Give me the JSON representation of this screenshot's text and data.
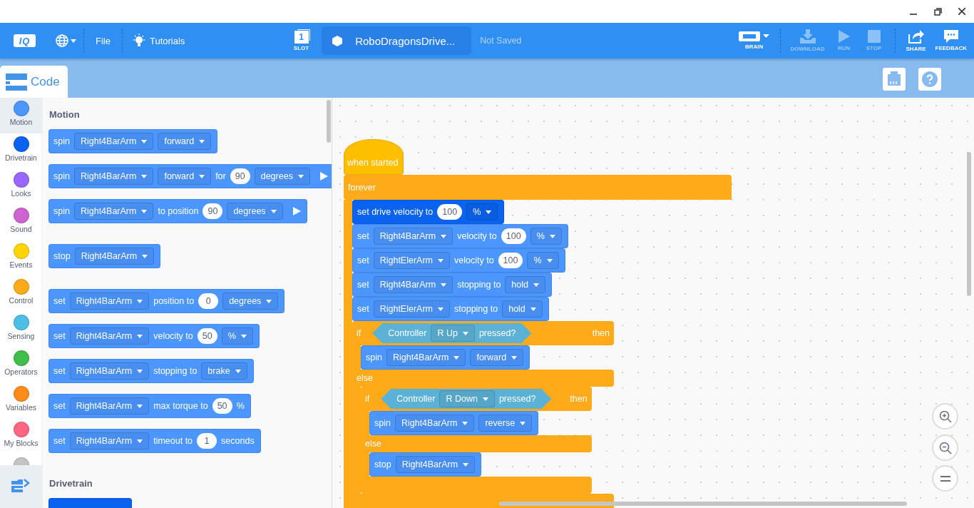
{
  "toolbar": {
    "logo": "IQ",
    "file": "File",
    "tutorials": "Tutorials",
    "slot": {
      "number": "1",
      "label": "SLOT"
    },
    "project_name": "RoboDragonsDrive...",
    "save_status": "Not Saved",
    "actions": [
      {
        "label": "BRAIN",
        "kind": "brain",
        "disabled": false
      },
      {
        "label": "DOWNLOAD",
        "kind": "download",
        "disabled": true
      },
      {
        "label": "RUN",
        "kind": "run",
        "disabled": true
      },
      {
        "label": "STOP",
        "kind": "stop",
        "disabled": true
      },
      {
        "label": "SHARE",
        "kind": "share",
        "disabled": false
      },
      {
        "label": "FEEDBACK",
        "kind": "feedback",
        "disabled": false
      }
    ]
  },
  "tabs": [
    {
      "label": "Code",
      "selected": true
    }
  ],
  "categories": [
    {
      "name": "Motion",
      "color": "#4c97ff",
      "selected": true
    },
    {
      "name": "Drivetrain",
      "color": "#0a63f0",
      "selected": false
    },
    {
      "name": "Looks",
      "color": "#9966ff",
      "selected": false
    },
    {
      "name": "Sound",
      "color": "#cf63cf",
      "selected": false
    },
    {
      "name": "Events",
      "color": "#ffd500",
      "selected": false
    },
    {
      "name": "Control",
      "color": "#ffab19",
      "selected": false
    },
    {
      "name": "Sensing",
      "color": "#4cbfe6",
      "selected": false
    },
    {
      "name": "Operators",
      "color": "#40bf4a",
      "selected": false
    },
    {
      "name": "Variables",
      "color": "#ff8c1a",
      "selected": false
    },
    {
      "name": "My Blocks",
      "color": "#ff6680",
      "selected": false
    },
    {
      "color": "#c4c4c4",
      "selected": false
    }
  ],
  "palette": [
    {
      "title": "Motion",
      "groups": [
        [
          {
            "color": "#4c97ff",
            "parts": [
              {
                "kind": "label",
                "text": "spin"
              },
              {
                "kind": "dropdown",
                "text": "Right4BarArm"
              },
              {
                "kind": "dropdown",
                "text": "forward"
              }
            ]
          },
          {
            "color": "#4c97ff",
            "parts": [
              {
                "kind": "label",
                "text": "spin"
              },
              {
                "kind": "dropdown",
                "text": "Right4BarArm"
              },
              {
                "kind": "dropdown",
                "text": "forward"
              },
              {
                "kind": "label",
                "text": "for"
              },
              {
                "kind": "number",
                "text": "90"
              },
              {
                "kind": "dropdown",
                "text": "degrees"
              },
              {
                "kind": "play"
              }
            ]
          },
          {
            "color": "#4c97ff",
            "parts": [
              {
                "kind": "label",
                "text": "spin"
              },
              {
                "kind": "dropdown",
                "text": "Right4BarArm"
              },
              {
                "kind": "label",
                "text": "to position"
              },
              {
                "kind": "number",
                "text": "90"
              },
              {
                "kind": "dropdown",
                "text": "degrees"
              },
              {
                "kind": "play"
              }
            ]
          }
        ],
        [
          {
            "color": "#4c97ff",
            "parts": [
              {
                "kind": "label",
                "text": "stop"
              },
              {
                "kind": "dropdown",
                "text": "Right4BarArm"
              }
            ]
          }
        ],
        [
          {
            "color": "#4c97ff",
            "parts": [
              {
                "kind": "label",
                "text": "set"
              },
              {
                "kind": "dropdown",
                "text": "Right4BarArm"
              },
              {
                "kind": "label",
                "text": "position to"
              },
              {
                "kind": "number",
                "text": "0"
              },
              {
                "kind": "dropdown",
                "text": "degrees"
              }
            ]
          },
          {
            "color": "#4c97ff",
            "parts": [
              {
                "kind": "label",
                "text": "set"
              },
              {
                "kind": "dropdown",
                "text": "Right4BarArm"
              },
              {
                "kind": "label",
                "text": "velocity to"
              },
              {
                "kind": "number",
                "text": "50"
              },
              {
                "kind": "dropdown",
                "text": "%"
              }
            ]
          },
          {
            "color": "#4c97ff",
            "parts": [
              {
                "kind": "label",
                "text": "set"
              },
              {
                "kind": "dropdown",
                "text": "Right4BarArm"
              },
              {
                "kind": "label",
                "text": "stopping to"
              },
              {
                "kind": "dropdown",
                "text": "brake"
              }
            ]
          },
          {
            "color": "#4c97ff",
            "parts": [
              {
                "kind": "label",
                "text": "set"
              },
              {
                "kind": "dropdown",
                "text": "Right4BarArm"
              },
              {
                "kind": "label",
                "text": "max torque to"
              },
              {
                "kind": "number",
                "text": "50"
              },
              {
                "kind": "label",
                "text": "%"
              }
            ]
          },
          {
            "color": "#4c97ff",
            "parts": [
              {
                "kind": "label",
                "text": "set"
              },
              {
                "kind": "dropdown",
                "text": "Right4BarArm"
              },
              {
                "kind": "label",
                "text": "timeout to"
              },
              {
                "kind": "number",
                "text": "1"
              },
              {
                "kind": "label",
                "text": "seconds"
              }
            ]
          }
        ]
      ]
    },
    {
      "title": "Drivetrain",
      "groups": [
        [
          {
            "color": "#0a63f0"
          }
        ]
      ]
    }
  ],
  "script": [
    {
      "kind": "hat",
      "color": "#ffbf00",
      "parts": [
        {
          "kind": "label",
          "text": "when started"
        }
      ]
    },
    {
      "kind": "forever",
      "color": "#ffab19",
      "label": "forever",
      "body": [
        {
          "kind": "block",
          "color": "#0a63f0",
          "parts": [
            {
              "kind": "label",
              "text": "set drive velocity to"
            },
            {
              "kind": "number",
              "text": "100"
            },
            {
              "kind": "dropdown",
              "text": "%"
            }
          ]
        },
        {
          "kind": "block",
          "color": "#4c97ff",
          "parts": [
            {
              "kind": "label",
              "text": "set"
            },
            {
              "kind": "dropdown",
              "text": "Right4BarArm"
            },
            {
              "kind": "label",
              "text": "velocity to"
            },
            {
              "kind": "number",
              "text": "100"
            },
            {
              "kind": "dropdown",
              "text": "%"
            }
          ]
        },
        {
          "kind": "block",
          "color": "#4c97ff",
          "parts": [
            {
              "kind": "label",
              "text": "set"
            },
            {
              "kind": "dropdown",
              "text": "RightElerArm"
            },
            {
              "kind": "label",
              "text": "velocity to"
            },
            {
              "kind": "number",
              "text": "100"
            },
            {
              "kind": "dropdown",
              "text": "%"
            }
          ]
        },
        {
          "kind": "block",
          "color": "#4c97ff",
          "parts": [
            {
              "kind": "label",
              "text": "set"
            },
            {
              "kind": "dropdown",
              "text": "Right4BarArm"
            },
            {
              "kind": "label",
              "text": "stopping to"
            },
            {
              "kind": "dropdown",
              "text": "hold"
            }
          ]
        },
        {
          "kind": "block",
          "color": "#4c97ff",
          "parts": [
            {
              "kind": "label",
              "text": "set"
            },
            {
              "kind": "dropdown",
              "text": "RightElerArm"
            },
            {
              "kind": "label",
              "text": "stopping to"
            },
            {
              "kind": "dropdown",
              "text": "hold"
            }
          ]
        },
        {
          "kind": "if_else",
          "color": "#ffab19",
          "if_label": "if",
          "then_label": "then",
          "else_label": "else",
          "condition": {
            "color": "#5cb1d6",
            "parts": [
              {
                "kind": "label",
                "text": "Controller"
              },
              {
                "kind": "dropdown",
                "text": "R Up"
              },
              {
                "kind": "label",
                "text": "pressed?"
              }
            ]
          },
          "then": [
            {
              "kind": "block",
              "color": "#4c97ff",
              "parts": [
                {
                  "kind": "label",
                  "text": "spin"
                },
                {
                  "kind": "dropdown",
                  "text": "Right4BarArm"
                },
                {
                  "kind": "dropdown",
                  "text": "forward"
                }
              ]
            }
          ],
          "else": [
            {
              "kind": "if_else",
              "color": "#ffab19",
              "if_label": "if",
              "then_label": "then",
              "else_label": "else",
              "condition": {
                "color": "#5cb1d6",
                "parts": [
                  {
                    "kind": "label",
                    "text": "Controller"
                  },
                  {
                    "kind": "dropdown",
                    "text": "R Down"
                  },
                  {
                    "kind": "label",
                    "text": "pressed?"
                  }
                ]
              },
              "then": [
                {
                  "kind": "block",
                  "color": "#4c97ff",
                  "parts": [
                    {
                      "kind": "label",
                      "text": "spin"
                    },
                    {
                      "kind": "dropdown",
                      "text": "Right4BarArm"
                    },
                    {
                      "kind": "dropdown",
                      "text": "reverse"
                    }
                  ]
                }
              ],
              "else": [
                {
                  "kind": "block",
                  "color": "#4c97ff",
                  "parts": [
                    {
                      "kind": "label",
                      "text": "stop"
                    },
                    {
                      "kind": "dropdown",
                      "text": "Right4BarArm"
                    }
                  ]
                }
              ]
            }
          ]
        }
      ]
    }
  ]
}
